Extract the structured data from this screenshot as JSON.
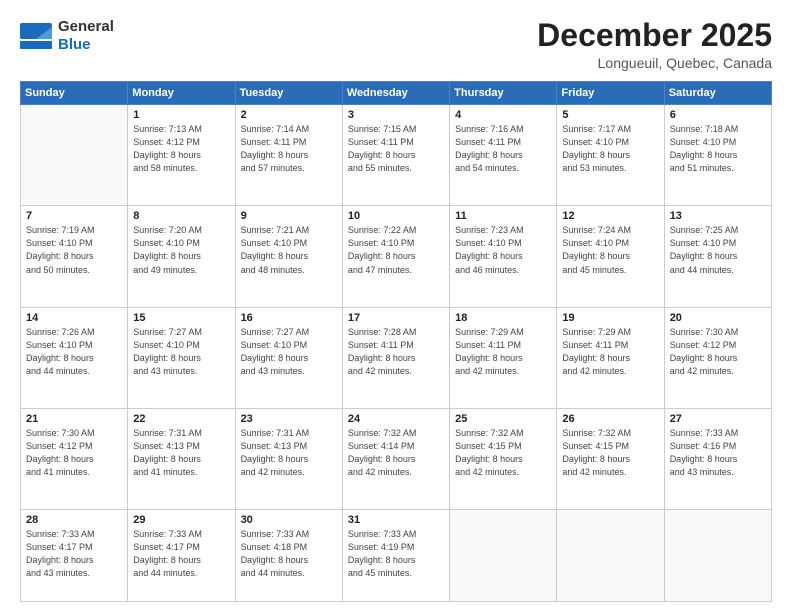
{
  "header": {
    "logo_general": "General",
    "logo_blue": "Blue",
    "month_title": "December 2025",
    "location": "Longueuil, Quebec, Canada"
  },
  "days_of_week": [
    "Sunday",
    "Monday",
    "Tuesday",
    "Wednesday",
    "Thursday",
    "Friday",
    "Saturday"
  ],
  "weeks": [
    [
      {
        "day": "",
        "info": ""
      },
      {
        "day": "1",
        "info": "Sunrise: 7:13 AM\nSunset: 4:12 PM\nDaylight: 8 hours\nand 58 minutes."
      },
      {
        "day": "2",
        "info": "Sunrise: 7:14 AM\nSunset: 4:11 PM\nDaylight: 8 hours\nand 57 minutes."
      },
      {
        "day": "3",
        "info": "Sunrise: 7:15 AM\nSunset: 4:11 PM\nDaylight: 8 hours\nand 55 minutes."
      },
      {
        "day": "4",
        "info": "Sunrise: 7:16 AM\nSunset: 4:11 PM\nDaylight: 8 hours\nand 54 minutes."
      },
      {
        "day": "5",
        "info": "Sunrise: 7:17 AM\nSunset: 4:10 PM\nDaylight: 8 hours\nand 53 minutes."
      },
      {
        "day": "6",
        "info": "Sunrise: 7:18 AM\nSunset: 4:10 PM\nDaylight: 8 hours\nand 51 minutes."
      }
    ],
    [
      {
        "day": "7",
        "info": "Sunrise: 7:19 AM\nSunset: 4:10 PM\nDaylight: 8 hours\nand 50 minutes."
      },
      {
        "day": "8",
        "info": "Sunrise: 7:20 AM\nSunset: 4:10 PM\nDaylight: 8 hours\nand 49 minutes."
      },
      {
        "day": "9",
        "info": "Sunrise: 7:21 AM\nSunset: 4:10 PM\nDaylight: 8 hours\nand 48 minutes."
      },
      {
        "day": "10",
        "info": "Sunrise: 7:22 AM\nSunset: 4:10 PM\nDaylight: 8 hours\nand 47 minutes."
      },
      {
        "day": "11",
        "info": "Sunrise: 7:23 AM\nSunset: 4:10 PM\nDaylight: 8 hours\nand 46 minutes."
      },
      {
        "day": "12",
        "info": "Sunrise: 7:24 AM\nSunset: 4:10 PM\nDaylight: 8 hours\nand 45 minutes."
      },
      {
        "day": "13",
        "info": "Sunrise: 7:25 AM\nSunset: 4:10 PM\nDaylight: 8 hours\nand 44 minutes."
      }
    ],
    [
      {
        "day": "14",
        "info": "Sunrise: 7:26 AM\nSunset: 4:10 PM\nDaylight: 8 hours\nand 44 minutes."
      },
      {
        "day": "15",
        "info": "Sunrise: 7:27 AM\nSunset: 4:10 PM\nDaylight: 8 hours\nand 43 minutes."
      },
      {
        "day": "16",
        "info": "Sunrise: 7:27 AM\nSunset: 4:10 PM\nDaylight: 8 hours\nand 43 minutes."
      },
      {
        "day": "17",
        "info": "Sunrise: 7:28 AM\nSunset: 4:11 PM\nDaylight: 8 hours\nand 42 minutes."
      },
      {
        "day": "18",
        "info": "Sunrise: 7:29 AM\nSunset: 4:11 PM\nDaylight: 8 hours\nand 42 minutes."
      },
      {
        "day": "19",
        "info": "Sunrise: 7:29 AM\nSunset: 4:11 PM\nDaylight: 8 hours\nand 42 minutes."
      },
      {
        "day": "20",
        "info": "Sunrise: 7:30 AM\nSunset: 4:12 PM\nDaylight: 8 hours\nand 42 minutes."
      }
    ],
    [
      {
        "day": "21",
        "info": "Sunrise: 7:30 AM\nSunset: 4:12 PM\nDaylight: 8 hours\nand 41 minutes."
      },
      {
        "day": "22",
        "info": "Sunrise: 7:31 AM\nSunset: 4:13 PM\nDaylight: 8 hours\nand 41 minutes."
      },
      {
        "day": "23",
        "info": "Sunrise: 7:31 AM\nSunset: 4:13 PM\nDaylight: 8 hours\nand 42 minutes."
      },
      {
        "day": "24",
        "info": "Sunrise: 7:32 AM\nSunset: 4:14 PM\nDaylight: 8 hours\nand 42 minutes."
      },
      {
        "day": "25",
        "info": "Sunrise: 7:32 AM\nSunset: 4:15 PM\nDaylight: 8 hours\nand 42 minutes."
      },
      {
        "day": "26",
        "info": "Sunrise: 7:32 AM\nSunset: 4:15 PM\nDaylight: 8 hours\nand 42 minutes."
      },
      {
        "day": "27",
        "info": "Sunrise: 7:33 AM\nSunset: 4:16 PM\nDaylight: 8 hours\nand 43 minutes."
      }
    ],
    [
      {
        "day": "28",
        "info": "Sunrise: 7:33 AM\nSunset: 4:17 PM\nDaylight: 8 hours\nand 43 minutes."
      },
      {
        "day": "29",
        "info": "Sunrise: 7:33 AM\nSunset: 4:17 PM\nDaylight: 8 hours\nand 44 minutes."
      },
      {
        "day": "30",
        "info": "Sunrise: 7:33 AM\nSunset: 4:18 PM\nDaylight: 8 hours\nand 44 minutes."
      },
      {
        "day": "31",
        "info": "Sunrise: 7:33 AM\nSunset: 4:19 PM\nDaylight: 8 hours\nand 45 minutes."
      },
      {
        "day": "",
        "info": ""
      },
      {
        "day": "",
        "info": ""
      },
      {
        "day": "",
        "info": ""
      }
    ]
  ]
}
